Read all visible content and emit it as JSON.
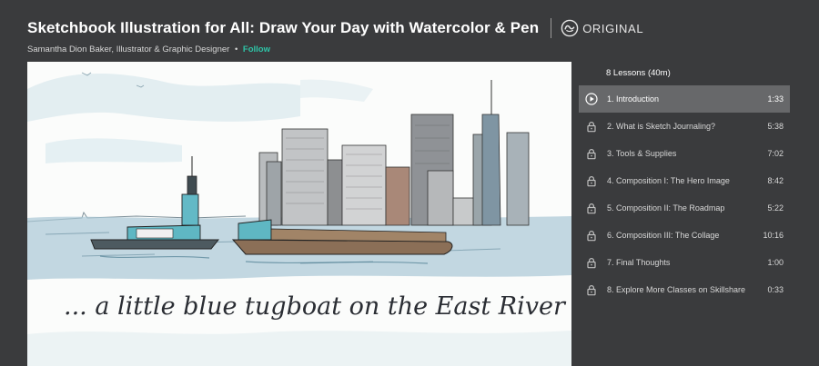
{
  "course": {
    "title": "Sketchbook Illustration for All: Draw Your Day with Watercolor & Pen",
    "badge": "ORIGINAL",
    "badge_icon": "skillshare-originals-icon",
    "instructor": "Samantha Dion Baker, Illustrator & Graphic Designer",
    "bullet": "•",
    "follow_label": "Follow"
  },
  "video": {
    "caption": "... a little blue tugboat on the East River"
  },
  "lessons": {
    "header": "8 Lessons (40m)",
    "items": [
      {
        "title": "1. Introduction",
        "duration": "1:33",
        "icon": "play-icon",
        "active": true
      },
      {
        "title": "2. What is Sketch Journaling?",
        "duration": "5:38",
        "icon": "lock-icon",
        "active": false
      },
      {
        "title": "3. Tools & Supplies",
        "duration": "7:02",
        "icon": "lock-icon",
        "active": false
      },
      {
        "title": "4. Composition I: The Hero Image",
        "duration": "8:42",
        "icon": "lock-icon",
        "active": false
      },
      {
        "title": "5. Composition II: The Roadmap",
        "duration": "5:22",
        "icon": "lock-icon",
        "active": false
      },
      {
        "title": "6. Composition III: The Collage",
        "duration": "10:16",
        "icon": "lock-icon",
        "active": false
      },
      {
        "title": "7. Final Thoughts",
        "duration": "1:00",
        "icon": "lock-icon",
        "active": false
      },
      {
        "title": "8. Explore More Classes on Skillshare",
        "duration": "0:33",
        "icon": "lock-icon",
        "active": false
      }
    ]
  },
  "colors": {
    "background": "#3a3b3d",
    "accent": "#2ec4a7",
    "active_row": "#67686a"
  }
}
